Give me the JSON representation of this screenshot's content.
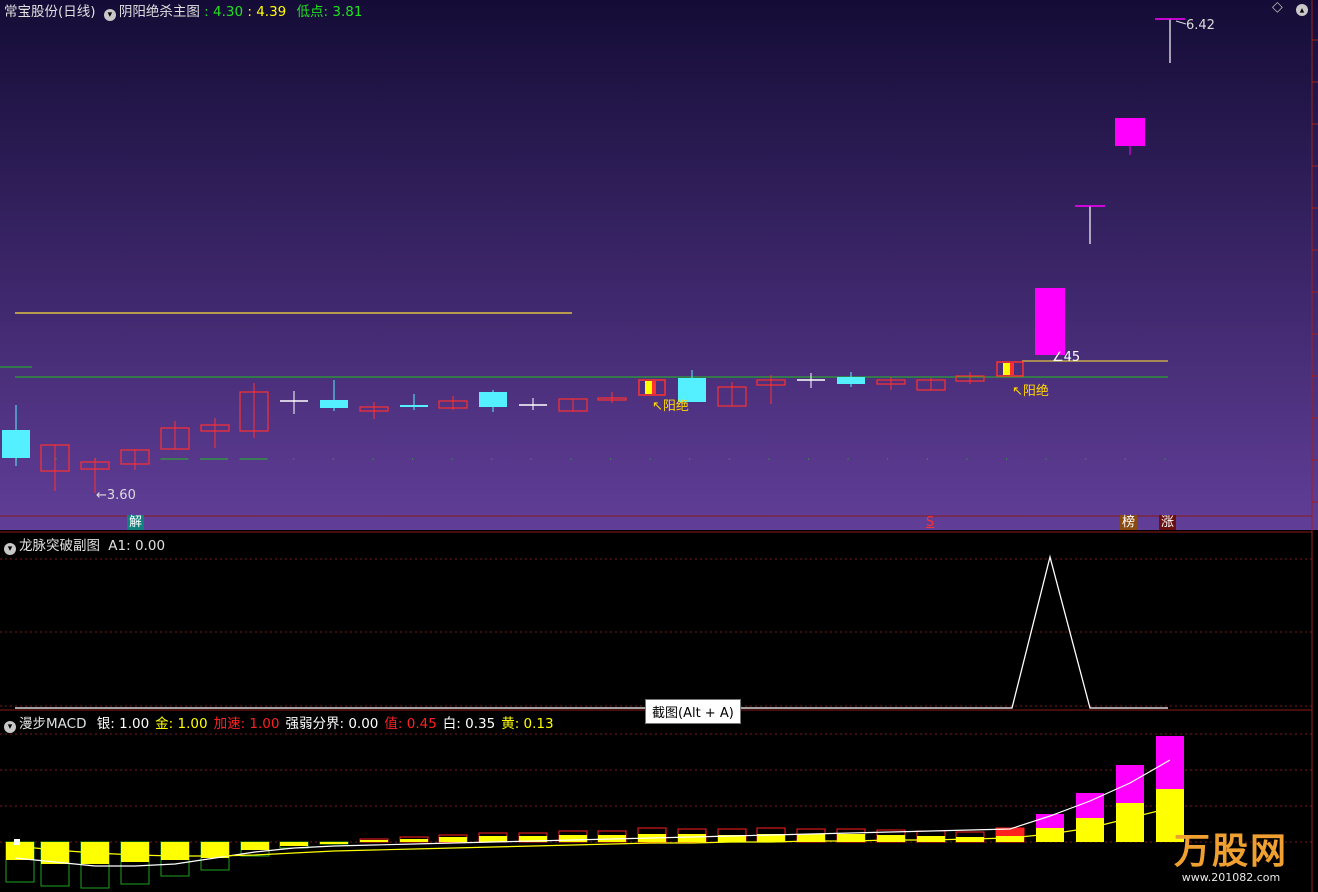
{
  "main_panel": {
    "title": "常宝股份(日线)",
    "indicator": "阴阳绝杀主图",
    "v1": "4.30",
    "v2": "4.39",
    "low_label": "低点",
    "low_value": "3.81",
    "price_high": "6.42",
    "price_low": "3.60",
    "mark_45": "45",
    "yangjue_1": "↖阳绝",
    "yangjue_2": "↖阳绝",
    "diamond": "◇",
    "bottom_tags": [
      "解",
      "S",
      "榜",
      "涨"
    ]
  },
  "sub_panel_1": {
    "name": "龙脉突破副图",
    "a1_label": "A1:",
    "a1_value": "0.00"
  },
  "sub_panel_2": {
    "name": "漫步MACD",
    "items": [
      {
        "label": "银:",
        "value": "1.00",
        "color": "#ffffff"
      },
      {
        "label": "金:",
        "value": "1.00",
        "color": "#ffff00"
      },
      {
        "label": "加速:",
        "value": "1.00",
        "color": "#ff2020"
      },
      {
        "label": "强弱分界:",
        "value": "0.00",
        "color": "#ffffff"
      },
      {
        "label": "值:",
        "value": "0.45",
        "color": "#ff2020"
      },
      {
        "label": "白:",
        "value": "0.35",
        "color": "#ffffff"
      },
      {
        "label": "黄:",
        "value": "0.13",
        "color": "#ffff00"
      }
    ]
  },
  "tooltip": "截图(Alt + A)",
  "watermark": {
    "logo": "万股网",
    "url": "www.201082.com"
  },
  "colors": {
    "up": "#ff3030",
    "down": "#55f0ff",
    "magenta": "#ff00ff",
    "yellow": "#ffff00",
    "green": "#20c020"
  }
}
